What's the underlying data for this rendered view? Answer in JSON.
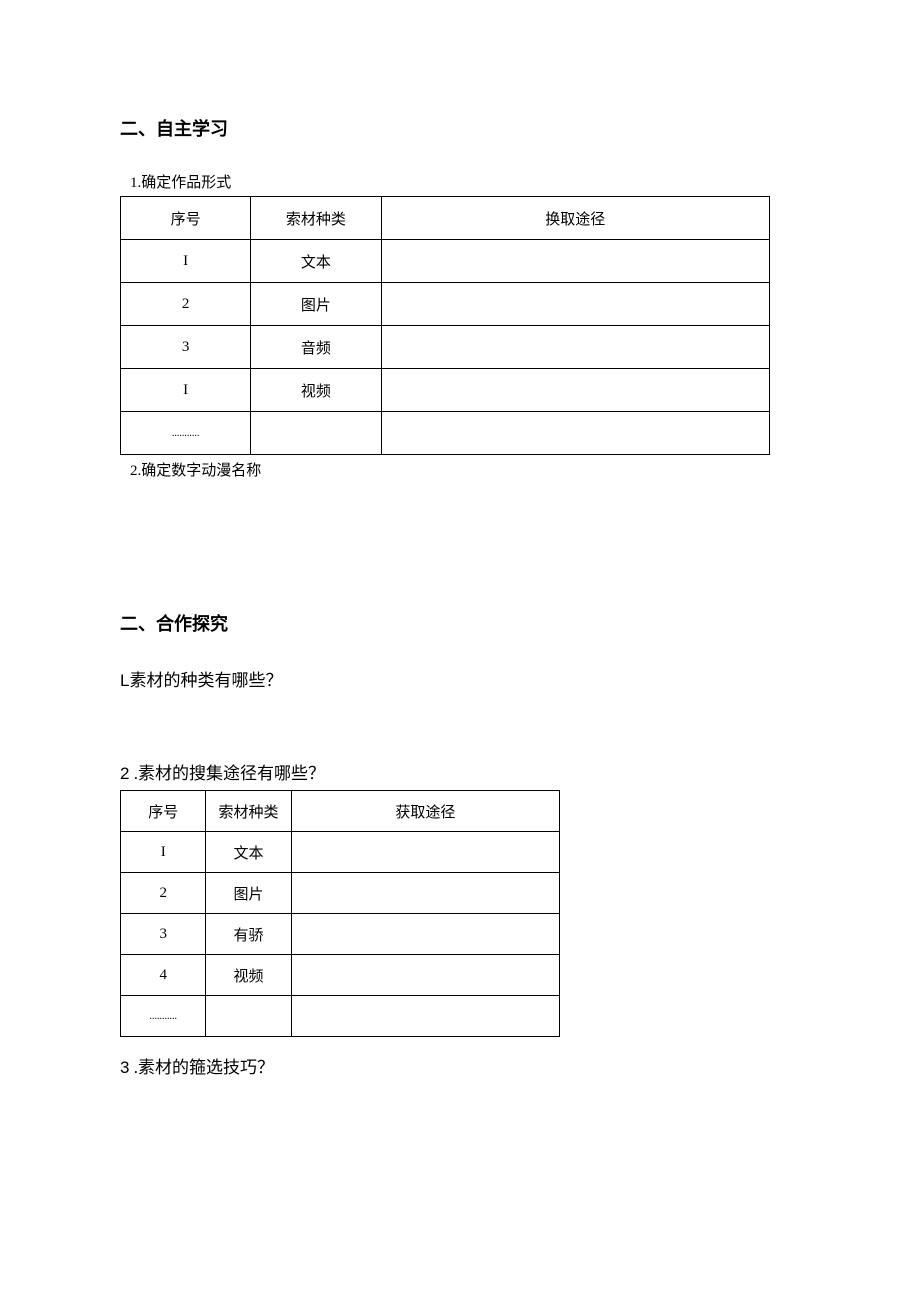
{
  "section1": {
    "heading": "二、自主学习",
    "item1": "1.确定作品形式",
    "item2": "2.确定数字动漫名称",
    "table": {
      "headers": {
        "col1": "序号",
        "col2": "索材种类",
        "col3": "换取途径"
      },
      "rows": [
        {
          "col1": "I",
          "col2": "文本",
          "col3": ""
        },
        {
          "col1": "2",
          "col2": "图片",
          "col3": ""
        },
        {
          "col1": "3",
          "col2": "音频",
          "col3": ""
        },
        {
          "col1": "I",
          "col2": "视频",
          "col3": ""
        },
        {
          "col1": "...........",
          "col2": "",
          "col3": ""
        }
      ]
    }
  },
  "section2": {
    "heading": "二、合作探究",
    "q1": {
      "num": "L",
      "text": "素材的种类有哪些？"
    },
    "q2": {
      "num": "2",
      "text": " .素材的搜集途径有哪些？"
    },
    "q3": {
      "num": "3",
      "text": " .素材的箍选技巧？"
    },
    "table": {
      "headers": {
        "col1": "序号",
        "col2": "索材种类",
        "col3": "获取途径"
      },
      "rows": [
        {
          "col1": "I",
          "col2": "文本",
          "col3": ""
        },
        {
          "col1": "2",
          "col2": "图片",
          "col3": ""
        },
        {
          "col1": "3",
          "col2": "有骄",
          "col3": ""
        },
        {
          "col1": "4",
          "col2": "视频",
          "col3": ""
        },
        {
          "col1": "...........",
          "col2": "",
          "col3": ""
        }
      ]
    }
  }
}
